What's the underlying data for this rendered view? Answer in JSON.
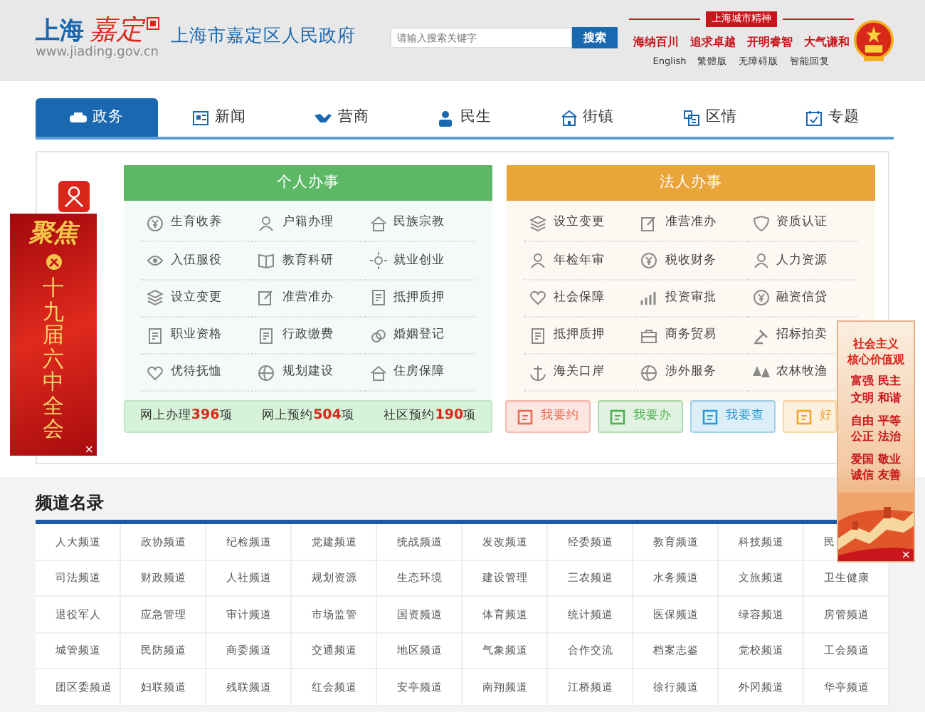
{
  "header": {
    "logo_city": "上海",
    "logo_district": "嘉定",
    "site_title": "上海市嘉定区人民政府",
    "url": "www.jiading.gov.cn",
    "search": {
      "placeholder": "请输入搜索关键字",
      "button": "搜索"
    },
    "spirit_tag": "上海城市精神",
    "slogans": [
      "海纳百川",
      "追求卓越",
      "开明睿智",
      "大气谦和"
    ],
    "links": [
      "English",
      "繁體版",
      "无障碍版",
      "智能回复"
    ]
  },
  "nav": [
    {
      "label": "政务",
      "selected": true
    },
    {
      "label": "新闻",
      "selected": false
    },
    {
      "label": "营商",
      "selected": false
    },
    {
      "label": "民生",
      "selected": false
    },
    {
      "label": "街镇",
      "selected": false
    },
    {
      "label": "区情",
      "selected": false
    },
    {
      "label": "专题",
      "selected": false
    }
  ],
  "personal": {
    "title": "个人办事",
    "items": [
      "生育收养",
      "户籍办理",
      "民族宗教",
      "入伍服役",
      "教育科研",
      "就业创业",
      "设立变更",
      "准营准办",
      "抵押质押",
      "职业资格",
      "行政缴费",
      "婚姻登记",
      "优待抚恤",
      "规划建设",
      "住房保障"
    ],
    "stats": [
      "网上办理**396**项",
      "网上预约**504**项",
      "社区预约**190**项"
    ]
  },
  "corporate": {
    "title": "法人办事",
    "items": [
      "设立变更",
      "准营准办",
      "资质认证",
      "年检年审",
      "税收财务",
      "人力资源",
      "社会保障",
      "投资审批",
      "融资信贷",
      "抵押质押",
      "商务贸易",
      "招标拍卖",
      "海关口岸",
      "涉外服务",
      "农林牧渔"
    ]
  },
  "quick_buttons": [
    {
      "label": "我要约",
      "color": "#e86a4f"
    },
    {
      "label": "我要办",
      "color": "#4caf50"
    },
    {
      "label": "我要查",
      "color": "#2a9bd6"
    },
    {
      "label": "好",
      "color": "#f0a531"
    }
  ],
  "left_ad": {
    "heading": "聚焦",
    "text": "十九届六中全会",
    "close": "×"
  },
  "right_ad": {
    "title": [
      "社会主义",
      "核心价值观"
    ],
    "values": [
      "富强 民主",
      "文明 和谐",
      "自由 平等",
      "公正 法治",
      "爱国 敬业",
      "诚信 友善"
    ],
    "close": "×"
  },
  "directory": {
    "title": "频道名录",
    "rows": [
      [
        "人大频道",
        "政协频道",
        "纪检频道",
        "党建频道",
        "统战频道",
        "发改频道",
        "经委频道",
        "教育频道",
        "科技频道",
        "民"
      ],
      [
        "司法频道",
        "财政频道",
        "人社频道",
        "规划资源",
        "生态环境",
        "建设管理",
        "三农频道",
        "水务频道",
        "文旅频道",
        "卫生健康"
      ],
      [
        "退役军人",
        "应急管理",
        "审计频道",
        "市场监管",
        "国资频道",
        "体育频道",
        "统计频道",
        "医保频道",
        "绿容频道",
        "房管频道"
      ],
      [
        "城管频道",
        "民防频道",
        "商委频道",
        "交通频道",
        "地区频道",
        "气象频道",
        "合作交流",
        "档案志鉴",
        "党校频道",
        "工会频道"
      ],
      [
        "团区委频道",
        "妇联频道",
        "残联频道",
        "红会频道",
        "安亭频道",
        "南翔频道",
        "江桥频道",
        "徐行频道",
        "外冈频道",
        "华亭频道"
      ]
    ]
  }
}
